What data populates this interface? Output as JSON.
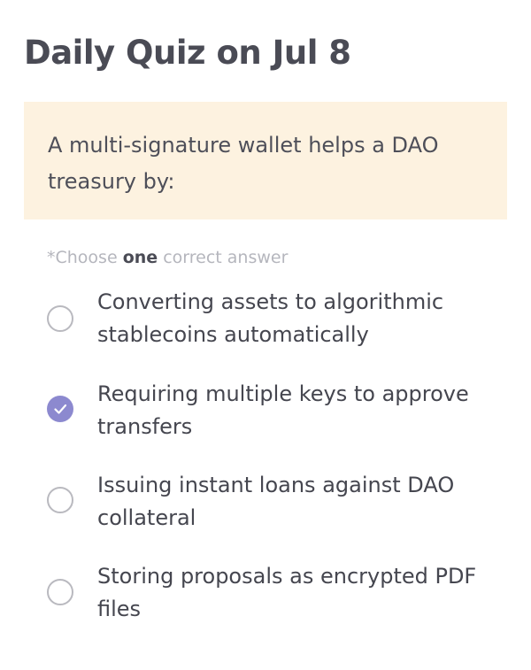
{
  "quiz": {
    "title": "Daily Quiz on Jul 8",
    "question": "A multi-signature wallet helps a DAO treasury by:",
    "instruction": {
      "prefix": "*Choose ",
      "emphasis": "one",
      "suffix": " correct answer"
    },
    "options": [
      {
        "label": "Converting assets to algorithmic stablecoins automatically",
        "selected": false
      },
      {
        "label": "Requiring multiple keys to approve transfers",
        "selected": true
      },
      {
        "label": "Issuing instant loans against DAO collateral",
        "selected": false
      },
      {
        "label": "Storing proposals as encrypted PDF files",
        "selected": false
      }
    ]
  },
  "colors": {
    "question_background": "#fdf2e0",
    "selected_accent": "#8c89cf",
    "radio_border": "#b9b9bf",
    "muted_text": "#b5b6bd"
  },
  "icons": {
    "selected_radio": "check-icon"
  }
}
